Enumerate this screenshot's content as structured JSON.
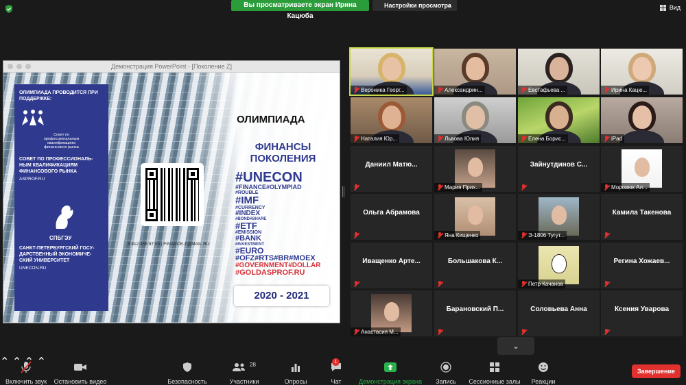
{
  "topbar": {
    "share_banner": "Вы просматриваете экран Ирина Кацюба",
    "view_options": "Настройки просмотра",
    "view_button": "Вид"
  },
  "share": {
    "window_title": "Демонстрация PowerPoint - [Поколение Z]",
    "slide": {
      "support_heading": "ОЛИМПИАДА ПРОВОДИТСЯ ПРИ ПОДДЕРЖКЕ:",
      "council_small": "Совет по профессиональным квалификациям финансового рынка",
      "council_name": "СОВЕТ ПО ПРОФЕССИОНАЛЬ-НЫМ КВАЛИФИКАЦИЯМ ФИНАНСОВОГО РЫНКА",
      "council_link": "ASPROF.RU",
      "uni_abbr": "СПБГЭУ",
      "uni_name": "САНКТ-ПЕТЕРБУРГСКИЙ ГОСУ-ДАРСТВЕННЫЙ ЭКОНОМИЧЕ-СКИЙ УНИВЕРСИТЕТ",
      "uni_link": "UNECON.RU",
      "contacts": "8 812 458 97 09 | FINANCE.Z@MAIL.RU",
      "olympiad": "ОЛИМПИАДА",
      "title_line1": "ФИНАНСЫ",
      "title_line2": "ПОКОЛЕНИЯ",
      "tags": [
        {
          "text": "#UNECON",
          "size": 20,
          "red": false
        },
        {
          "text": "#FINANCE#OLYMPIAD",
          "size": 9,
          "red": false
        },
        {
          "text": "#ROUBLE",
          "size": 7,
          "red": false
        },
        {
          "text": "#IMF",
          "size": 15,
          "red": false
        },
        {
          "text": "#CURRENCY",
          "size": 7,
          "red": false
        },
        {
          "text": "#INDEX",
          "size": 10,
          "red": false
        },
        {
          "text": "#BOND#SHARE",
          "size": 6,
          "red": false
        },
        {
          "text": "#ETF",
          "size": 13,
          "red": false
        },
        {
          "text": "#EMISSION",
          "size": 7,
          "red": false
        },
        {
          "text": "#BANK",
          "size": 11,
          "red": false
        },
        {
          "text": "#INVESTMENT",
          "size": 6,
          "red": false
        },
        {
          "text": "#EURO",
          "size": 12,
          "red": false
        },
        {
          "text": "#OFZ#RTS#BR#MOEX",
          "size": 11,
          "red": false
        },
        {
          "text": "#GOVERNMENT#DOLLAR",
          "size": 10,
          "red": true
        },
        {
          "text": "#GOLDASPROF.RU",
          "size": 11,
          "red": true
        }
      ],
      "years": "2020 - 2021"
    }
  },
  "participants": [
    {
      "name": "Вероника Георг...",
      "type": "video",
      "active": true
    },
    {
      "name": "Александрин...",
      "type": "video"
    },
    {
      "name": "Евстафьева ...",
      "type": "video"
    },
    {
      "name": "Ирина Кацю...",
      "type": "video"
    },
    {
      "name": "Наталия Юр...",
      "type": "video"
    },
    {
      "name": "Львова Юлия",
      "type": "video"
    },
    {
      "name": "Елена Борис...",
      "type": "video"
    },
    {
      "name": "iPad",
      "type": "video"
    },
    {
      "name": "Даниил Матю...",
      "type": "text"
    },
    {
      "name": "Мария Прих...",
      "type": "photo"
    },
    {
      "name": "Зайнутдинов С...",
      "type": "text"
    },
    {
      "name": "Моровюк Ал...",
      "type": "photo"
    },
    {
      "name": "Ольга Абрамова",
      "type": "text"
    },
    {
      "name": "Яна Кищенко",
      "type": "photo"
    },
    {
      "name": "Э-1806 Тугут...",
      "type": "photo"
    },
    {
      "name": "Камила Такенова",
      "type": "text"
    },
    {
      "name": "Иващенко Арте...",
      "type": "text"
    },
    {
      "name": "Большакова К...",
      "type": "text"
    },
    {
      "name": "Петр Качанов",
      "type": "photo"
    },
    {
      "name": "Регина Хожаев...",
      "type": "text"
    },
    {
      "name": "Анастасия М...",
      "type": "photo"
    },
    {
      "name": "Барановский П...",
      "type": "text"
    },
    {
      "name": "Соловьева Анна",
      "type": "text"
    },
    {
      "name": "Ксения Уварова",
      "type": "text"
    }
  ],
  "toolbar": {
    "unmute": "Включить звук",
    "stop_video": "Остановить видео",
    "security": "Безопасность",
    "participants": "Участники",
    "participants_count": "28",
    "polls": "Опросы",
    "chat": "Чат",
    "chat_badge": "1",
    "share_screen": "Демонстрация экрана",
    "record": "Запись",
    "breakout": "Сессионные залы",
    "reactions": "Реакции",
    "end": "Завершение"
  },
  "colors": {
    "share_green": "#2b9c3a",
    "end_red": "#e0312f",
    "active_speaker": "#c8d84a",
    "slide_blue": "#2f3a8f"
  }
}
